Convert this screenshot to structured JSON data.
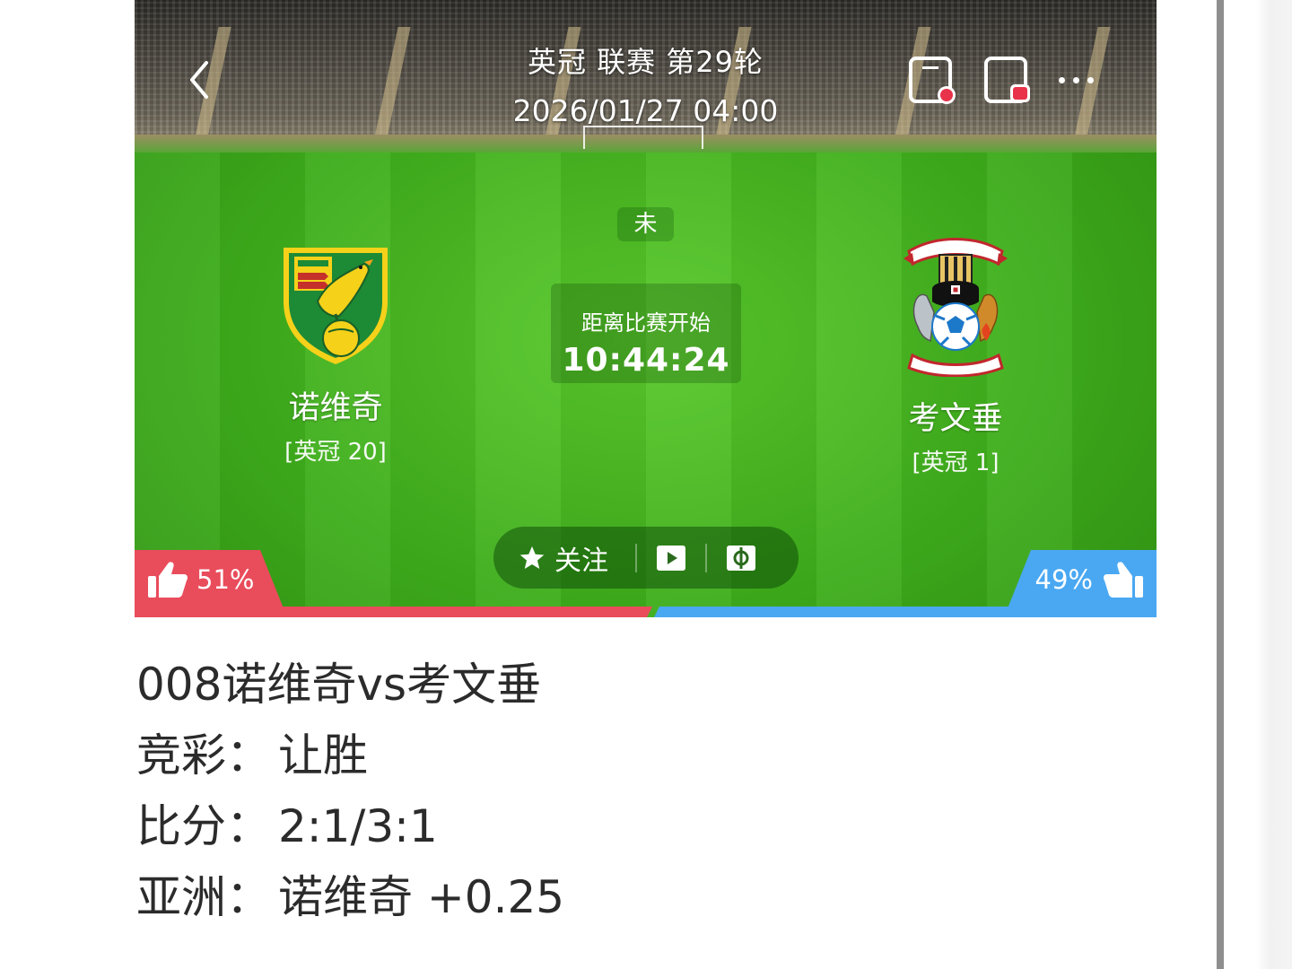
{
  "header": {
    "league_round": "英冠 联赛 第29轮",
    "match_time": "2026/01/27 04:00",
    "status": "未",
    "countdown_label": "距离比赛开始",
    "countdown": "10:44:24"
  },
  "home_team": {
    "name": "诺维奇",
    "rank": "[英冠 20]",
    "logo_icon": "norwich-canary-crest-icon"
  },
  "away_team": {
    "name": "考文垂",
    "rank": "[英冠 1]",
    "logo_icon": "coventry-elephant-crest-icon"
  },
  "actions": {
    "follow_label": "关注",
    "follow_icon": "star-icon",
    "video_icon": "play-icon",
    "animation_icon": "pitch-icon"
  },
  "votes": {
    "home_pct": "51%",
    "away_pct": "49%",
    "home_share": 0.51,
    "home_color": "#e94c5b",
    "away_color": "#4aa8f2"
  },
  "summary": {
    "title": "008诺维奇vs考文垂",
    "lines": [
      {
        "label": "竞彩：",
        "value": "让胜"
      },
      {
        "label": "比分：",
        "value": "2:1/3:1"
      },
      {
        "label": "亚洲：",
        "value": "诺维奇 +0.25"
      }
    ]
  },
  "colors": {
    "pitch": "#3fae1c",
    "live_dot": "#e8334a"
  }
}
